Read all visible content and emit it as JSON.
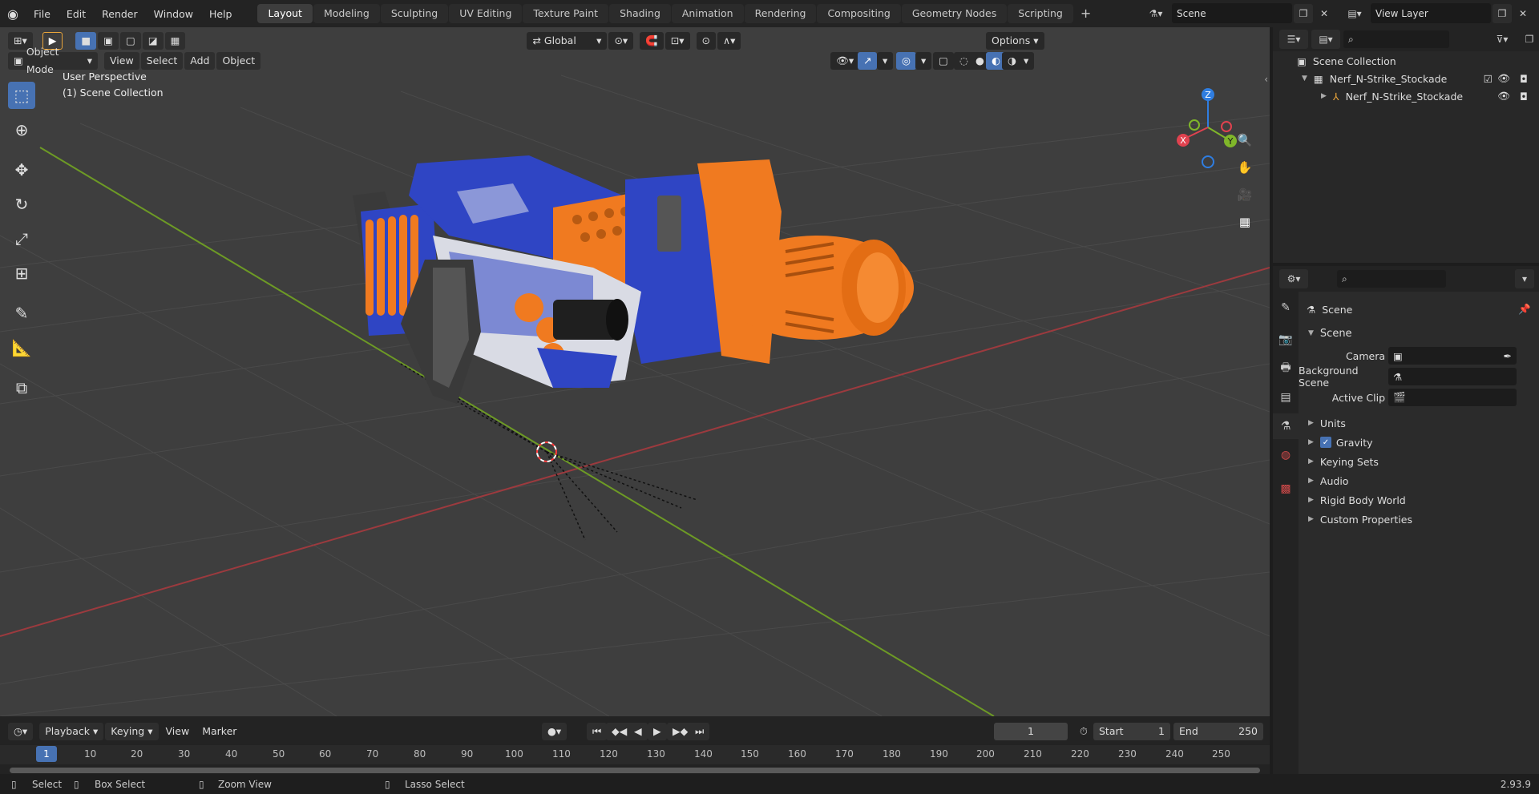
{
  "topbar": {
    "menus": [
      "File",
      "Edit",
      "Render",
      "Window",
      "Help"
    ],
    "workspaces": [
      "Layout",
      "Modeling",
      "Sculpting",
      "UV Editing",
      "Texture Paint",
      "Shading",
      "Animation",
      "Rendering",
      "Compositing",
      "Geometry Nodes",
      "Scripting"
    ],
    "active_workspace": "Layout",
    "add_tab": "+",
    "scene": "Scene",
    "view_layer": "View Layer"
  },
  "viewport": {
    "orientation": "Global",
    "options": "Options",
    "mode": "Object Mode",
    "menus": [
      "View",
      "Select",
      "Add",
      "Object"
    ],
    "perspective": "User Perspective",
    "collection": "(1) Scene Collection",
    "gizmo": {
      "x": "X",
      "y": "Y",
      "z": "Z"
    }
  },
  "timeline": {
    "menus": [
      "Playback",
      "Keying",
      "View",
      "Marker"
    ],
    "current_frame": "1",
    "start_label": "Start",
    "start": "1",
    "end_label": "End",
    "end": "250",
    "ruler": [
      "1",
      "10",
      "20",
      "30",
      "40",
      "50",
      "60",
      "70",
      "80",
      "90",
      "100",
      "110",
      "120",
      "130",
      "140",
      "150",
      "160",
      "170",
      "180",
      "190",
      "200",
      "210",
      "220",
      "230",
      "240",
      "250"
    ]
  },
  "statusbar": {
    "select": "Select",
    "box_select": "Box Select",
    "zoom_view": "Zoom View",
    "lasso_select": "Lasso Select",
    "version": "2.93.9"
  },
  "outliner": {
    "root": "Scene Collection",
    "collection": "Nerf_N-Strike_Stockade",
    "object": "Nerf_N-Strike_Stockade"
  },
  "properties": {
    "context": "Scene",
    "panel": "Scene",
    "camera_label": "Camera",
    "background_label": "Background Scene",
    "clip_label": "Active Clip",
    "sections": [
      "Units",
      "Gravity",
      "Keying Sets",
      "Audio",
      "Rigid Body World",
      "Custom Properties"
    ]
  },
  "colors": {
    "accent": "#4772b3",
    "x_axis": "#e0424f",
    "y_axis": "#80b72a",
    "z_axis": "#2f7de0",
    "blue_body": "#2f45c4",
    "orange": "#f07a20"
  }
}
